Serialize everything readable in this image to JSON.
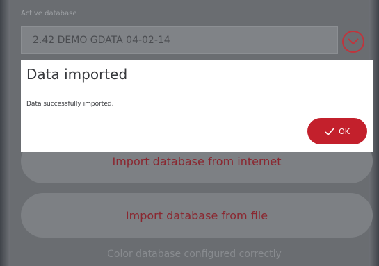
{
  "active_database": {
    "label": "Active database",
    "value": "2.42  DEMO GDATA 04-02-14",
    "dropdown_icon": "chevron-down-circle-icon"
  },
  "buttons": {
    "import_internet": "Import database from internet",
    "import_file": "Import database from file"
  },
  "status_text": "Color database configured correctly",
  "dialog": {
    "title": "Data imported",
    "message": "Data successfully imported.",
    "ok_label": "OK",
    "ok_icon": "checkmark-icon"
  },
  "colors": {
    "accent": "#c3202c",
    "button_text": "#8a2730",
    "overlay_bg": "#6a6d71"
  }
}
